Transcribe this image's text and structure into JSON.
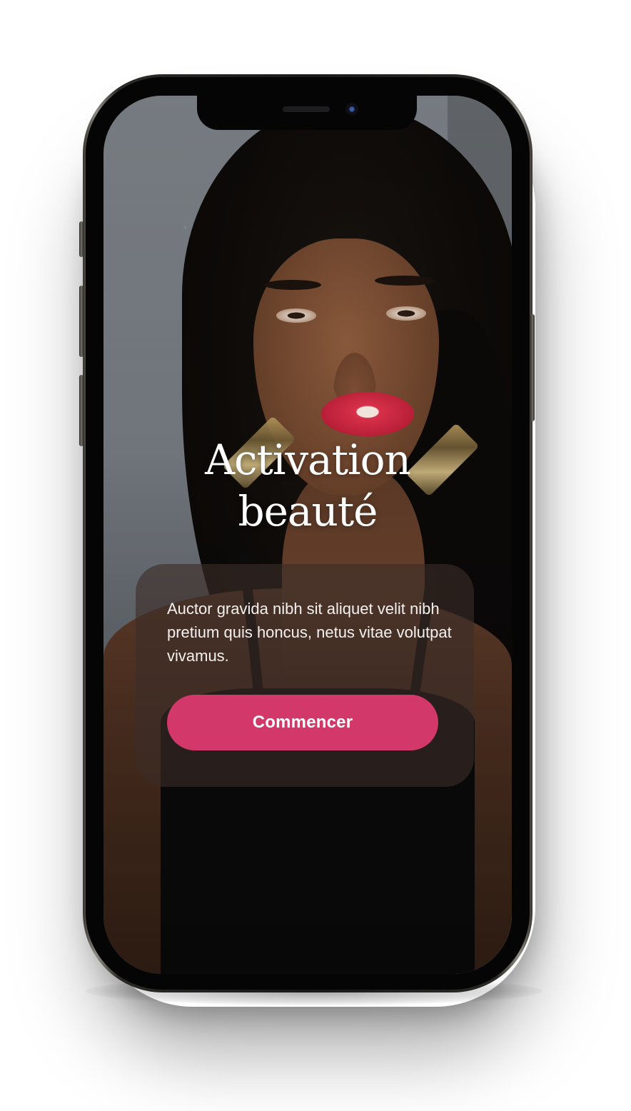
{
  "onboarding": {
    "title_line1": "Activation",
    "title_line2": "beauté",
    "description": "Auctor gravida nibh sit aliquet velit nibh pretium quis honcus, netus vitae volutpat vivamus.",
    "cta_label": "Commencer"
  },
  "colors": {
    "accent": "#d2386a",
    "card_overlay": "#3c2d28",
    "text": "#ffffff"
  }
}
